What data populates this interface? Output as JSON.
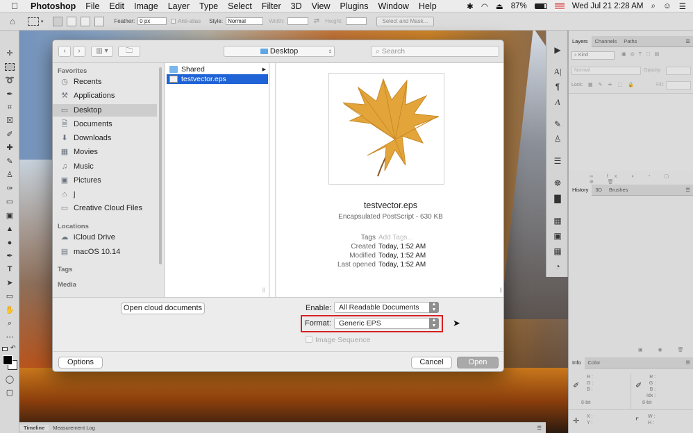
{
  "menubar": {
    "app_name": "Photoshop",
    "items": [
      "File",
      "Edit",
      "Image",
      "Layer",
      "Type",
      "Select",
      "Filter",
      "3D",
      "View",
      "Plugins",
      "Window",
      "Help"
    ],
    "battery": "87%",
    "datetime": "Wed Jul 21  2:28 AM"
  },
  "options_bar": {
    "feather_label": "Feather:",
    "feather_value": "0 px",
    "antialias_label": "Anti-alias",
    "style_label": "Style:",
    "style_value": "Normal",
    "width_label": "Width:",
    "height_label": "Height:",
    "select_mask_label": "Select and Mask..."
  },
  "layers_panel": {
    "tabs": [
      "Layers",
      "Channels",
      "Paths"
    ],
    "kind_placeholder": "Kind",
    "blend_mode": "Normal",
    "opacity_label": "Opacity:",
    "lock_label": "Lock:",
    "fill_label": "Fill:"
  },
  "history_panel": {
    "tabs": [
      "History",
      "3D",
      "Brushes"
    ]
  },
  "info_panel": {
    "tabs": [
      "Info",
      "Color"
    ],
    "rgb_labels": [
      "R :",
      "G :",
      "B :"
    ],
    "bit_depth": "8-bit",
    "right_labels": [
      "R :",
      "G :",
      "B :",
      "Idx :"
    ],
    "xy_labels": [
      "X :",
      "Y :"
    ],
    "wh_labels": [
      "W :",
      "H :"
    ]
  },
  "timeline_bar": {
    "tabs": [
      "Timeline",
      "Measurement Log"
    ]
  },
  "dialog": {
    "location": "Desktop",
    "search_placeholder": "Search",
    "sidebar": {
      "favorites_header": "Favorites",
      "favorites": [
        {
          "label": "Recents",
          "icon": "clock-icon"
        },
        {
          "label": "Applications",
          "icon": "applications-icon"
        },
        {
          "label": "Desktop",
          "icon": "desktop-icon",
          "selected": true
        },
        {
          "label": "Documents",
          "icon": "documents-icon"
        },
        {
          "label": "Downloads",
          "icon": "downloads-icon"
        },
        {
          "label": "Movies",
          "icon": "movies-icon"
        },
        {
          "label": "Music",
          "icon": "music-icon"
        },
        {
          "label": "Pictures",
          "icon": "pictures-icon"
        },
        {
          "label": "j",
          "icon": "home-icon"
        },
        {
          "label": "Creative Cloud Files",
          "icon": "folder-icon"
        }
      ],
      "locations_header": "Locations",
      "locations": [
        {
          "label": "iCloud Drive",
          "icon": "cloud-icon"
        },
        {
          "label": "macOS 10.14",
          "icon": "disk-icon"
        }
      ],
      "tags_header": "Tags",
      "media_header": "Media"
    },
    "files": [
      {
        "name": "Shared",
        "type": "folder"
      },
      {
        "name": "testvector.eps",
        "type": "file",
        "selected": true
      }
    ],
    "preview": {
      "filename": "testvector.eps",
      "kind": "Encapsulated PostScript - 630 KB",
      "tags_label": "Tags",
      "tags_value": "Add Tags...",
      "created_label": "Created",
      "created_value": "Today, 1:52 AM",
      "modified_label": "Modified",
      "modified_value": "Today, 1:52 AM",
      "opened_label": "Last opened",
      "opened_value": "Today, 1:52 AM"
    },
    "open_cloud_label": "Open cloud documents",
    "enable_label": "Enable:",
    "enable_value": "All Readable Documents",
    "format_label": "Format:",
    "format_value": "Generic EPS",
    "image_sequence_label": "Image Sequence",
    "options_label": "Options",
    "cancel_label": "Cancel",
    "open_label": "Open",
    "highlight_color": "#d92020",
    "selection_color": "#1f63d6"
  }
}
